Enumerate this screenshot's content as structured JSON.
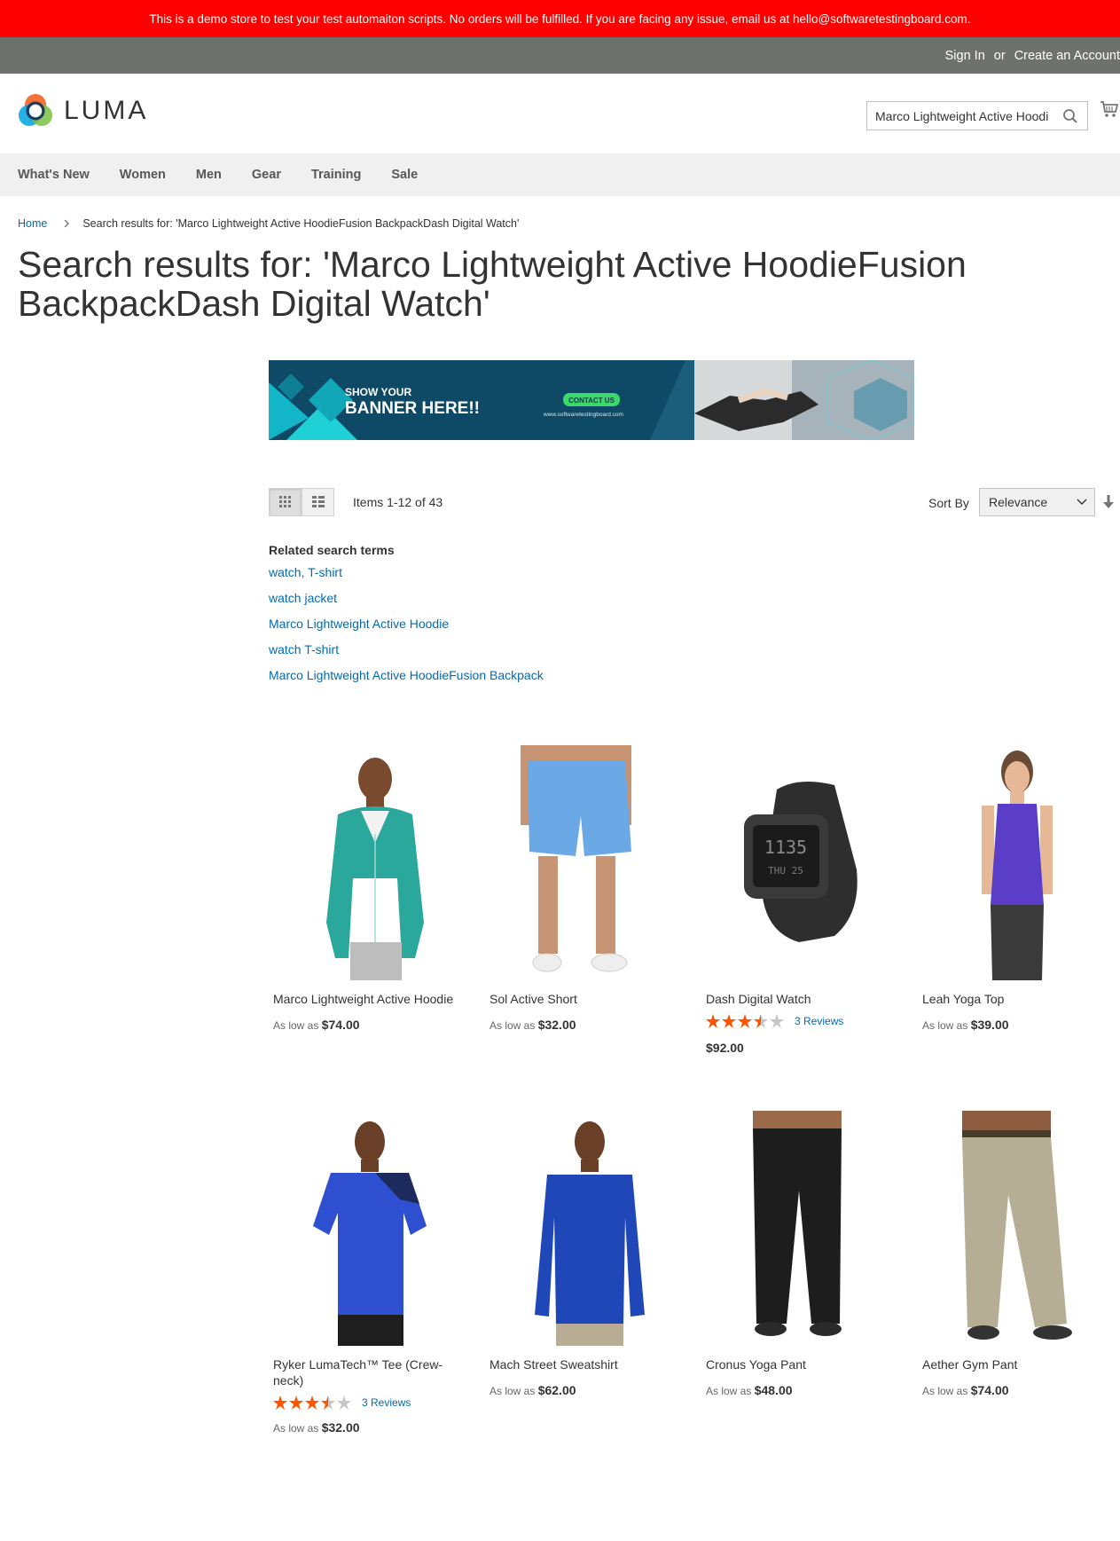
{
  "demo_notice": "This is a demo store to test your test automaiton scripts. No orders will be fulfilled. If you are facing any issue, email us at hello@softwaretestingboard.com.",
  "header_links": {
    "sign_in": "Sign In",
    "or": "or",
    "create_account": "Create an Account"
  },
  "logo": {
    "text": "LUMA"
  },
  "search": {
    "value": "Marco Lightweight Active Hoodi"
  },
  "nav": [
    "What's New",
    "Women",
    "Men",
    "Gear",
    "Training",
    "Sale"
  ],
  "breadcrumb": {
    "home": "Home",
    "current": "Search results for: 'Marco Lightweight Active HoodieFusion BackpackDash Digital Watch'"
  },
  "page_title": "Search results for: 'Marco Lightweight Active HoodieFusion BackpackDash Digital Watch'",
  "banner": {
    "line1": "SHOW YOUR",
    "line2": "BANNER HERE!!",
    "cta": "CONTACT US",
    "url": "www.softwaretestingboard.com"
  },
  "toolbar": {
    "items_count": "Items 1-12 of 43",
    "sort_label": "Sort By",
    "sort_value": "Relevance"
  },
  "related": {
    "title": "Related search terms",
    "terms": [
      "watch, T-shirt",
      "watch jacket",
      "Marco Lightweight Active Hoodie",
      "watch T-shirt",
      "Marco Lightweight Active HoodieFusion Backpack"
    ]
  },
  "products": [
    {
      "name": "Marco Lightweight Active Hoodie",
      "prefix": "As low as",
      "price": "$74.00"
    },
    {
      "name": "Sol Active Short",
      "prefix": "As low as",
      "price": "$32.00"
    },
    {
      "name": "Dash Digital Watch",
      "rating": 3.5,
      "reviews": "3 Reviews",
      "price": "$92.00"
    },
    {
      "name": "Leah Yoga Top",
      "prefix": "As low as",
      "price": "$39.00"
    },
    {
      "name": "Ryker LumaTech™ Tee (Crew-neck)",
      "rating": 3.5,
      "reviews": "3 Reviews",
      "prefix": "As low as",
      "price": "$32.00"
    },
    {
      "name": "Mach Street Sweatshirt",
      "prefix": "As low as",
      "price": "$62.00"
    },
    {
      "name": "Cronus Yoga Pant",
      "prefix": "As low as",
      "price": "$48.00"
    },
    {
      "name": "Aether Gym Pant",
      "prefix": "As low as",
      "price": "$74.00"
    }
  ],
  "colors": {
    "demo_bar": "#ff0000",
    "top_bar": "#6e716e",
    "link": "#006bb4",
    "star": "#ff5501",
    "nav_bg": "#f0f0f0"
  }
}
